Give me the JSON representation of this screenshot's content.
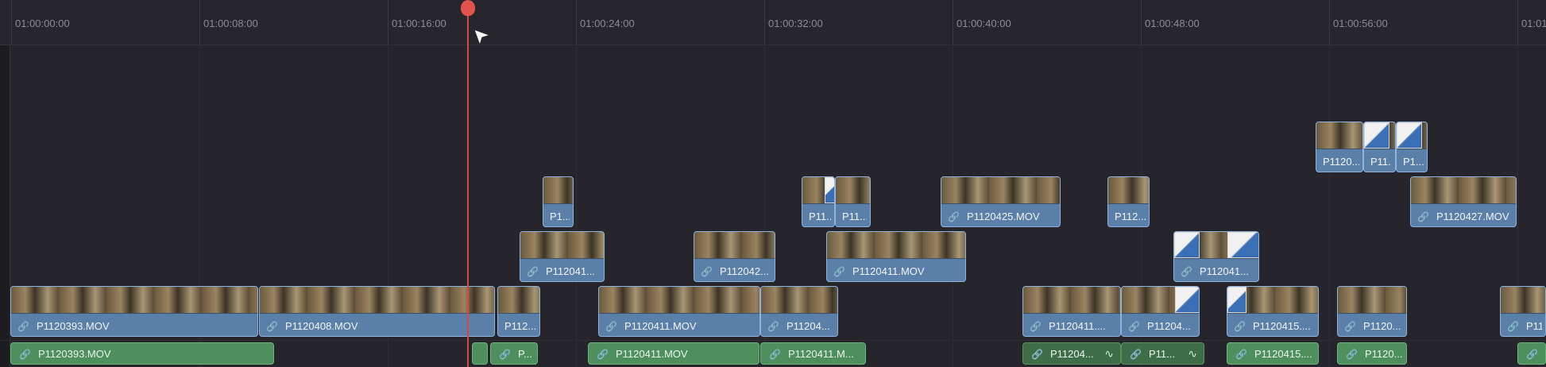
{
  "ruler": {
    "timecodes": [
      "01:00:00:00",
      "01:00:08:00",
      "01:00:16:00",
      "01:00:24:00",
      "01:00:32:00",
      "01:00:40:00",
      "01:00:48:00",
      "01:00:56:00",
      "01:01"
    ]
  },
  "colors": {
    "video_clip": "#5a7fa8",
    "audio_clip": "#4d8f5d",
    "playhead": "#e2544b",
    "background": "#25252b"
  },
  "icons": {
    "link": "link-icon",
    "waveform": "waveform-icon",
    "cursor": "pointer-cursor-icon"
  },
  "playhead": {
    "timecode": "01:00:19:00"
  },
  "video_tracks": {
    "v5": [
      {
        "label": "P1120...",
        "transition": false
      },
      {
        "label": "P11...",
        "transition": true
      },
      {
        "label": "P1...",
        "transition": true
      }
    ],
    "v4": [
      {
        "label": "P1..."
      },
      {
        "label": "P11..."
      },
      {
        "label": "P11..."
      },
      {
        "label": "P1120425.MOV"
      },
      {
        "label": "P112..."
      },
      {
        "label": "P1120427.MOV"
      }
    ],
    "v3": [
      {
        "label": "P112041..."
      },
      {
        "label": "P112042..."
      },
      {
        "label": "P1120411.MOV"
      },
      {
        "label": "P112041..."
      }
    ],
    "v1": [
      {
        "label": "P1120393.MOV"
      },
      {
        "label": "P1120408.MOV"
      },
      {
        "label": "P112..."
      },
      {
        "label": "P1120411.MOV"
      },
      {
        "label": "P11204..."
      },
      {
        "label": "P1120411...."
      },
      {
        "label": "P11204..."
      },
      {
        "label": "P1120415...."
      },
      {
        "label": "P1120..."
      },
      {
        "label": "P11..."
      }
    ]
  },
  "audio_track": [
    {
      "label": "P1120393.MOV"
    },
    {
      "label": "P..."
    },
    {
      "label": "P1120411.MOV"
    },
    {
      "label": "P1120411.M..."
    },
    {
      "label": "P11204..."
    },
    {
      "label": "P11..."
    },
    {
      "label": "P1120415...."
    },
    {
      "label": "P1120..."
    },
    {
      "label": ""
    }
  ]
}
